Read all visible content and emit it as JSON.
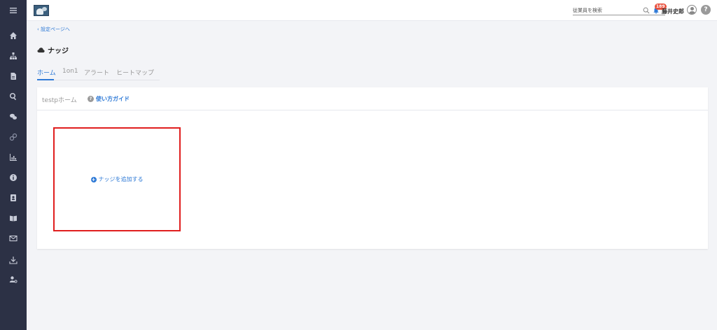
{
  "sidebar": {
    "items": [
      {
        "icon": "menu-icon"
      },
      {
        "icon": "home-icon"
      },
      {
        "icon": "org-chart-icon"
      },
      {
        "icon": "document-icon"
      },
      {
        "icon": "search-icon"
      },
      {
        "icon": "chat-icon"
      },
      {
        "icon": "link-icon"
      },
      {
        "icon": "chart-icon"
      },
      {
        "icon": "info-icon"
      },
      {
        "icon": "contact-icon"
      },
      {
        "icon": "book-icon"
      },
      {
        "icon": "mail-icon"
      },
      {
        "icon": "download-icon"
      },
      {
        "icon": "user-settings-icon"
      }
    ]
  },
  "topbar": {
    "search_placeholder": "従業員を検索",
    "notification_count": "189",
    "username": "藤井史郎",
    "help_label": "?"
  },
  "main": {
    "back_link": "設定ページへ",
    "title": "ナッジ",
    "tabs": [
      {
        "label": "ホーム",
        "active": true
      },
      {
        "label": "1on1",
        "active": false
      },
      {
        "label": "アラート",
        "active": false
      },
      {
        "label": "ヒートマップ",
        "active": false
      }
    ],
    "card": {
      "title": "testpホーム",
      "guide_label": "使い方ガイド",
      "add_label": "ナッジを追加する"
    }
  },
  "colors": {
    "accent": "#2f7ad6",
    "sidebar_bg": "#2c3145",
    "highlight_border": "#e01e1e",
    "badge": "#e9523f"
  }
}
